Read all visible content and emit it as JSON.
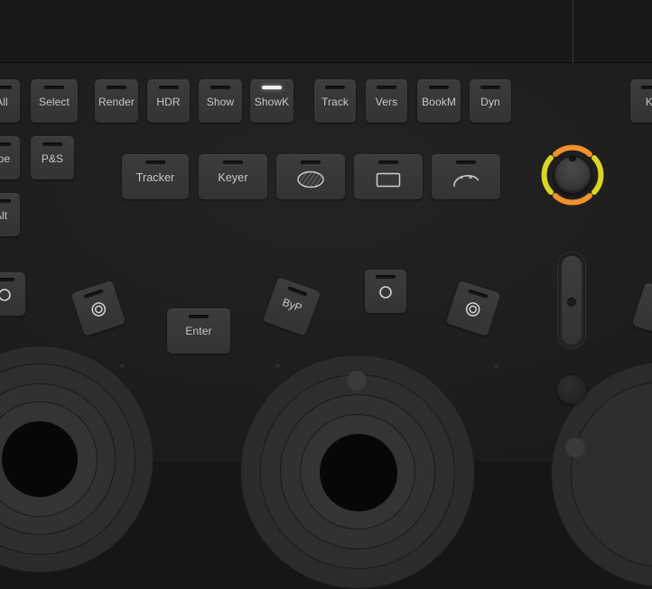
{
  "panel": {
    "name": "color-grading-control-surface",
    "background_color": "#1e1e1e",
    "button_color": "#363636",
    "led_active_color": "#efefef",
    "joystick_arc_vertical_color": "#f0912b",
    "joystick_arc_horizontal_color": "#d8d626"
  },
  "top_panel": {
    "label": ""
  },
  "soft_buttons_row1": [
    {
      "label": "All",
      "led": "off"
    },
    {
      "label": "Select",
      "led": "off"
    },
    {
      "label": "Render",
      "led": "off"
    },
    {
      "label": "HDR",
      "led": "off"
    },
    {
      "label": "Show",
      "led": "off"
    },
    {
      "label": "ShowK",
      "led": "on"
    },
    {
      "label": "Track",
      "led": "off"
    },
    {
      "label": "Vers",
      "led": "off"
    },
    {
      "label": "BookM",
      "led": "off"
    },
    {
      "label": "Dyn",
      "led": "off"
    },
    {
      "label": "K-",
      "led": "off"
    }
  ],
  "soft_buttons_row2": [
    {
      "label": "ape",
      "led": "off"
    },
    {
      "label": "P&S",
      "led": "off"
    }
  ],
  "soft_buttons_row3": [
    {
      "label": "Alt",
      "led": "off"
    }
  ],
  "tool_buttons": [
    {
      "label": "Tracker",
      "icon": "",
      "led": "off"
    },
    {
      "label": "Keyer",
      "icon": "",
      "led": "off"
    },
    {
      "label": "",
      "icon": "ellipse-window-icon",
      "led": "off"
    },
    {
      "label": "",
      "icon": "rectangle-window-icon",
      "led": "off"
    },
    {
      "label": "",
      "icon": "curve-window-icon",
      "led": "off"
    }
  ],
  "joystick": {
    "name": "pan-tilt-joystick",
    "arcs": [
      "top",
      "right",
      "bottom",
      "left"
    ]
  },
  "lower_buttons": [
    {
      "label": "",
      "icon": "circle-icon",
      "rotation": 0,
      "led": "off"
    },
    {
      "label": "",
      "icon": "double-ring-icon",
      "rotation": -18,
      "led": "off"
    },
    {
      "label": "Enter",
      "icon": "",
      "rotation": 0,
      "led": "off"
    },
    {
      "label": "ByP",
      "icon": "",
      "rotation": 20,
      "led": "off"
    },
    {
      "label": "",
      "icon": "circle-icon",
      "rotation": 0,
      "led": "off"
    },
    {
      "label": "",
      "icon": "double-ring-icon",
      "rotation": 18,
      "led": "off"
    }
  ],
  "slider": {
    "name": "vertical-fader",
    "value_position_pct": 48
  },
  "trackballs": [
    {
      "name": "trackball-left"
    },
    {
      "name": "trackball-right"
    }
  ]
}
